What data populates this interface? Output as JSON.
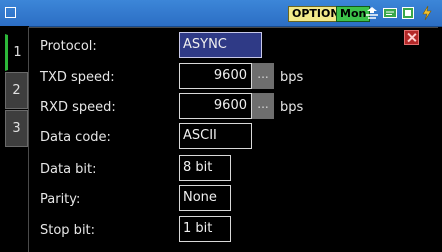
{
  "header": {
    "option_label": "OPTION",
    "mon_label": "Mon",
    "icons": [
      "window-icon",
      "network-icon",
      "card-icon",
      "storage-icon",
      "power-icon"
    ]
  },
  "tabs": [
    {
      "label": "1",
      "active": true
    },
    {
      "label": "2",
      "active": false
    },
    {
      "label": "3",
      "active": false
    }
  ],
  "settings": {
    "protocol": {
      "label": "Protocol:",
      "value": "ASYNC"
    },
    "txd_speed": {
      "label": "TXD speed:",
      "value": "9600",
      "button": "...",
      "unit": "bps"
    },
    "rxd_speed": {
      "label": "RXD speed:",
      "value": "9600",
      "button": "...",
      "unit": "bps"
    },
    "data_code": {
      "label": "Data code:",
      "value": "ASCII"
    },
    "data_bit": {
      "label": "Data bit:",
      "value": "8 bit"
    },
    "parity": {
      "label": "Parity:",
      "value": "None"
    },
    "stop_bit": {
      "label": "Stop bit:",
      "value": "1 bit"
    }
  },
  "colors": {
    "topbar": "#2f74cc",
    "selected_field": "#2f3a86",
    "active_tab_accent": "#2db83a",
    "close_button": "#b42828"
  }
}
